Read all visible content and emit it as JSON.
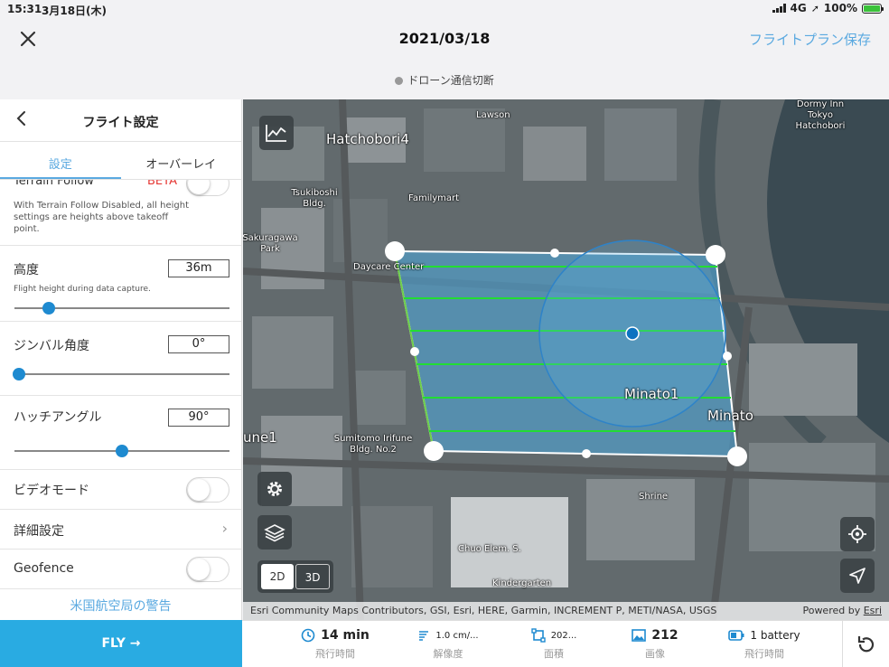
{
  "statusbar": {
    "time": "15:31",
    "date": "3月18日(木)",
    "network": "4G",
    "battery": "100%"
  },
  "nav": {
    "title": "2021/03/18",
    "save_label": "フライトプラン保存"
  },
  "drone_status": "ドローン通信切断",
  "panel": {
    "title": "フライト設定",
    "tabs": [
      {
        "label": "設定"
      },
      {
        "label": "オーバーレイ"
      }
    ],
    "terrain_follow": {
      "label": "Terrain Follow",
      "badge": "BETA",
      "description": "With Terrain Follow Disabled, all height settings are heights above takeoff point."
    },
    "altitude": {
      "label": "高度",
      "value": "36m",
      "description": "Flight height during data capture.",
      "slider_fraction": 0.16
    },
    "gimbal": {
      "label": "ジンバル角度",
      "value": "0°",
      "slider_fraction": 0.02
    },
    "hatch": {
      "label": "ハッチアングル",
      "value": "90°",
      "slider_fraction": 0.5
    },
    "video_mode": {
      "label": "ビデオモード"
    },
    "advanced": {
      "label": "詳細設定"
    },
    "geofence": {
      "label": "Geofence"
    },
    "faa_warning": "米国航空局の警告",
    "fly_label": "FLY →"
  },
  "map": {
    "labels": {
      "hatchobori": "Hatchobori4",
      "lawson": "Lawson",
      "dormy": "Dormy Inn Tokyo Hatchobori",
      "tsukiboshi": "Tsukiboshi Bldg.",
      "familymart": "Familymart",
      "sakuragawa": "Sakuragawa Park",
      "daycare": "Daycare Center",
      "minato1": "Minato1",
      "minato": "Minato",
      "irifune1": "une1",
      "sumitomo": "Sumitomo Irifune Bldg. No.2",
      "shrine": "Shrine",
      "chuo": "Chuo Elem. S.",
      "kindergarten": "Kindergarten"
    },
    "mode_2d": "2D",
    "mode_3d": "3D",
    "attribution": "Esri Community Maps Contributors, GSI, Esri, HERE, Garmin, INCREMENT P, METI/NASA, USGS",
    "powered_by": "Powered by",
    "esri": "Esri"
  },
  "stats": [
    {
      "value": "14 min",
      "label": "飛行時間",
      "icon": "clock-icon"
    },
    {
      "value": "1.0 cm/...",
      "label": "解像度",
      "icon": "resolution-icon"
    },
    {
      "value": "202...",
      "label": "面積",
      "icon": "area-icon"
    },
    {
      "value": "212",
      "label": "画像",
      "icon": "image-icon"
    },
    {
      "value": "1 battery",
      "label": "飛行時間",
      "icon": "battery-icon"
    }
  ],
  "colors": {
    "accent": "#5aa9e0",
    "fly_button": "#29abe2",
    "flight_line": "#22dd33",
    "polygon_fill": "#4fa6d8",
    "slider": "#1e8ad0",
    "beta": "#e53935"
  }
}
